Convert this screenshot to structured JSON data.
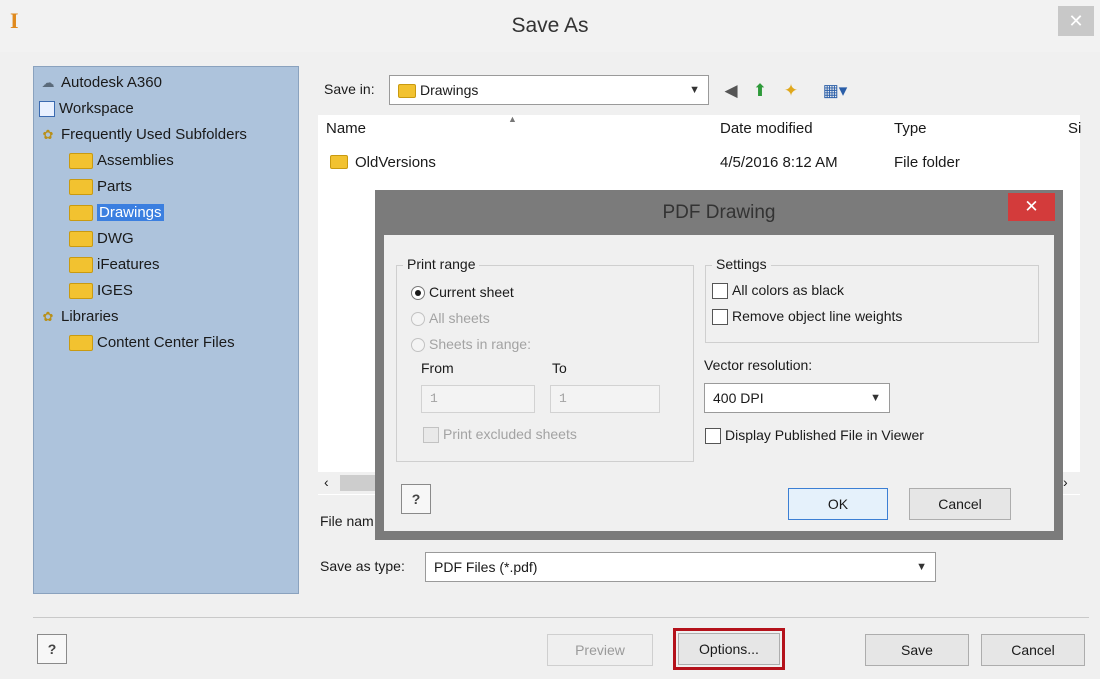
{
  "save_as": {
    "title": "Save As",
    "close_glyph": "✕",
    "app_icon_glyph": "I",
    "sidebar": {
      "items": [
        {
          "label": "Autodesk A360",
          "icon": "cloud-icon"
        },
        {
          "label": "Workspace",
          "icon": "workspace-icon"
        },
        {
          "label": "Frequently Used Subfolders",
          "icon": "folder-group-icon"
        },
        {
          "label": "Assemblies",
          "icon": "folder-icon"
        },
        {
          "label": "Parts",
          "icon": "folder-icon"
        },
        {
          "label": "Drawings",
          "icon": "folder-icon",
          "selected": true
        },
        {
          "label": "DWG",
          "icon": "folder-icon"
        },
        {
          "label": "iFeatures",
          "icon": "folder-icon"
        },
        {
          "label": "IGES",
          "icon": "folder-icon"
        },
        {
          "label": "Libraries",
          "icon": "folder-group-icon"
        },
        {
          "label": "Content Center Files",
          "icon": "folder-icon"
        }
      ]
    },
    "save_in": {
      "label": "Save in:",
      "value": "Drawings"
    },
    "toolbar_icons": [
      "back-icon",
      "up-folder-icon",
      "new-folder-icon",
      "view-menu-icon"
    ],
    "columns": [
      "Name",
      "Date modified",
      "Type",
      "Si"
    ],
    "rows": [
      {
        "name": "OldVersions",
        "date": "4/5/2016 8:12 AM",
        "type": "File folder"
      }
    ],
    "file_name_label": "File nam",
    "save_as_type": {
      "label": "Save as type:",
      "value": "PDF Files (*.pdf)"
    },
    "buttons": {
      "preview": "Preview",
      "options": "Options...",
      "save": "Save",
      "cancel": "Cancel"
    },
    "highlight_color": "#b4121b"
  },
  "pdf_dialog": {
    "title": "PDF Drawing",
    "close_glyph": "✕",
    "print_range": {
      "title": "Print range",
      "current_sheet": "Current sheet",
      "all_sheets": "All sheets",
      "sheets_in_range": "Sheets in range:",
      "from_label": "From",
      "to_label": "To",
      "from_value": "1",
      "to_value": "1",
      "print_excluded": "Print excluded sheets"
    },
    "settings": {
      "title": "Settings",
      "all_colors_black": "All colors as black",
      "remove_line_weights": "Remove object line weights"
    },
    "vector_resolution": {
      "label": "Vector resolution:",
      "value": "400 DPI"
    },
    "display_in_viewer": "Display Published File in Viewer",
    "buttons": {
      "ok": "OK",
      "cancel": "Cancel"
    },
    "close_color": "#d33b3b"
  }
}
